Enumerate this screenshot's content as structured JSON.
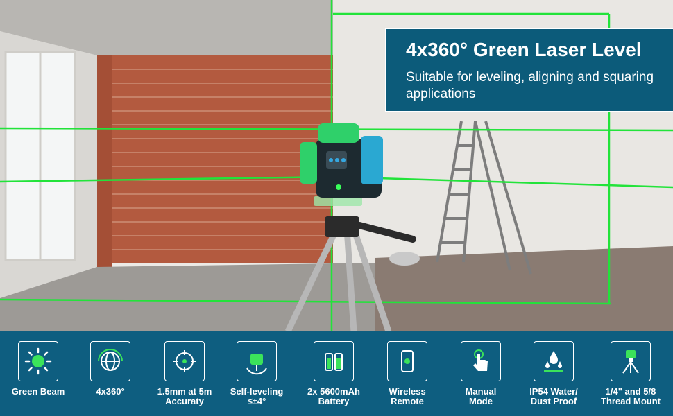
{
  "banner": {
    "title": "4x360° Green Laser Level",
    "subtitle": "Suitable for leveling, aligning and squaring applications"
  },
  "features": [
    {
      "icon": "sun-icon",
      "label_line1": "Green Beam",
      "label_line2": ""
    },
    {
      "icon": "globe-360-icon",
      "label_line1": "4x360°",
      "label_line2": ""
    },
    {
      "icon": "accuracy-target-icon",
      "label_line1": "1.5mm at 5m",
      "label_line2": "Accuraty"
    },
    {
      "icon": "self-leveling-icon",
      "label_line1": "Self-leveling",
      "label_line2": "≤±4°"
    },
    {
      "icon": "battery-icon",
      "label_line1": "2x 5600mAh",
      "label_line2": "Battery"
    },
    {
      "icon": "remote-icon",
      "label_line1": "Wireless",
      "label_line2": "Remote"
    },
    {
      "icon": "hand-pointer-icon",
      "label_line1": "Manual",
      "label_line2": "Mode"
    },
    {
      "icon": "water-drops-icon",
      "label_line1": "IP54 Water/",
      "label_line2": "Dust Proof"
    },
    {
      "icon": "tripod-mount-icon",
      "label_line1": "1/4\" and 5/8",
      "label_line2": "Thread Mount"
    }
  ],
  "colors": {
    "laser": "#22e33a",
    "banner_bg": "#0c5b7a",
    "features_bg": "#0e5e80",
    "icon_green": "#3be35a"
  }
}
